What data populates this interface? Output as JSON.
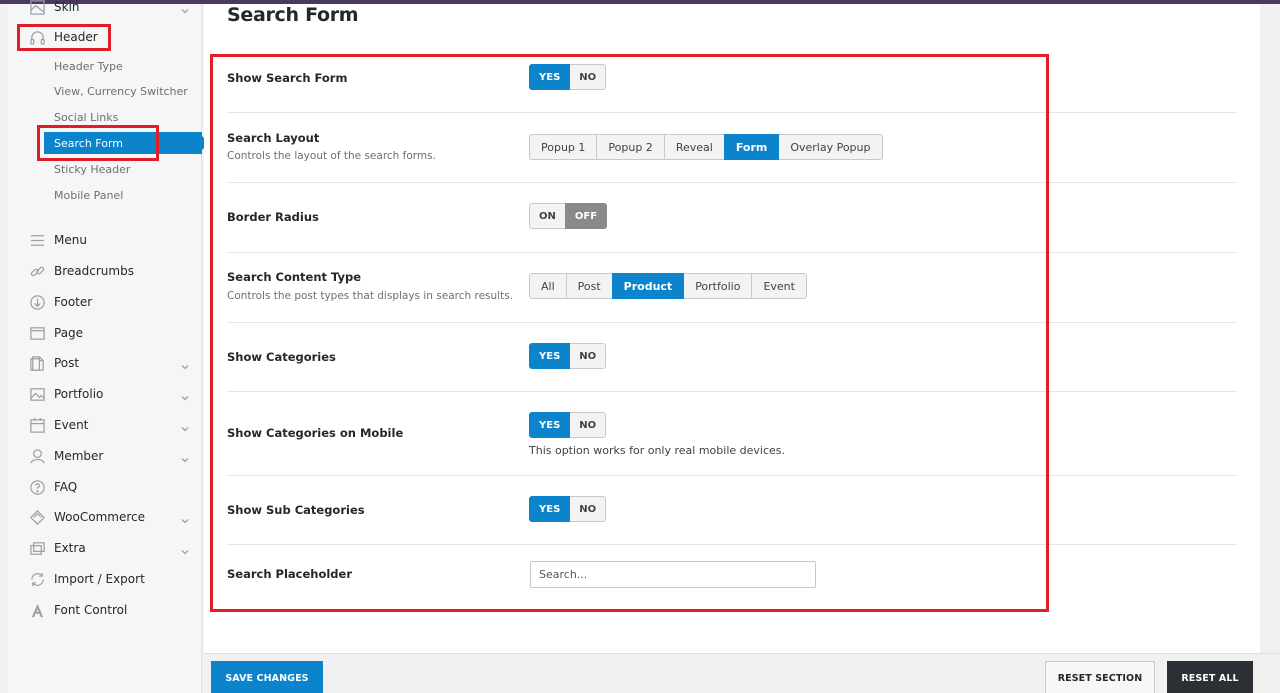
{
  "sidebar": {
    "top_partial": "Skin",
    "header": "Header",
    "sub_items": [
      "Header Type",
      "View, Currency Switcher",
      "Social Links",
      "Search Form",
      "Sticky Header",
      "Mobile Panel"
    ],
    "active_sub": "Search Form",
    "items": [
      {
        "label": "Menu",
        "icon": "menu-icon",
        "has_chevron": false
      },
      {
        "label": "Breadcrumbs",
        "icon": "link-icon",
        "has_chevron": false
      },
      {
        "label": "Footer",
        "icon": "arrow-down-circle-icon",
        "has_chevron": false
      },
      {
        "label": "Page",
        "icon": "page-icon",
        "has_chevron": false
      },
      {
        "label": "Post",
        "icon": "post-icon",
        "has_chevron": true
      },
      {
        "label": "Portfolio",
        "icon": "image-icon",
        "has_chevron": true
      },
      {
        "label": "Event",
        "icon": "calendar-icon",
        "has_chevron": true
      },
      {
        "label": "Member",
        "icon": "user-icon",
        "has_chevron": true
      },
      {
        "label": "FAQ",
        "icon": "question-icon",
        "has_chevron": false
      },
      {
        "label": "WooCommerce",
        "icon": "woo-icon",
        "has_chevron": true
      },
      {
        "label": "Extra",
        "icon": "layers-icon",
        "has_chevron": true
      },
      {
        "label": "Import / Export",
        "icon": "refresh-icon",
        "has_chevron": false
      },
      {
        "label": "Font Control",
        "icon": "font-icon",
        "has_chevron": false
      }
    ]
  },
  "main": {
    "title": "Search Form",
    "rows": {
      "show_search_form": {
        "label": "Show Search Form",
        "yes": "YES",
        "no": "NO",
        "selected": "YES"
      },
      "search_layout": {
        "label": "Search Layout",
        "desc": "Controls the layout of the search forms.",
        "options": [
          "Popup 1",
          "Popup 2",
          "Reveal",
          "Form",
          "Overlay Popup"
        ],
        "selected": "Form"
      },
      "border_radius": {
        "label": "Border Radius",
        "on": "ON",
        "off": "OFF",
        "selected": "OFF"
      },
      "search_content_type": {
        "label": "Search Content Type",
        "desc": "Controls the post types that displays in search results.",
        "options": [
          "All",
          "Post",
          "Product",
          "Portfolio",
          "Event"
        ],
        "selected": "Product"
      },
      "show_categories": {
        "label": "Show Categories",
        "yes": "YES",
        "no": "NO",
        "selected": "YES"
      },
      "show_categories_mobile": {
        "label": "Show Categories on Mobile",
        "yes": "YES",
        "no": "NO",
        "selected": "YES",
        "note": "This option works for only real mobile devices."
      },
      "show_sub_categories": {
        "label": "Show Sub Categories",
        "yes": "YES",
        "no": "NO",
        "selected": "YES"
      },
      "search_placeholder": {
        "label": "Search Placeholder",
        "value": "",
        "placeholder": "Search..."
      }
    }
  },
  "footer": {
    "save": "SAVE CHANGES",
    "reset_section": "RESET SECTION",
    "reset_all": "RESET ALL"
  },
  "colors": {
    "accent": "#0c84cc",
    "highlight": "#e01e2a",
    "dark_button": "#2c3034"
  }
}
